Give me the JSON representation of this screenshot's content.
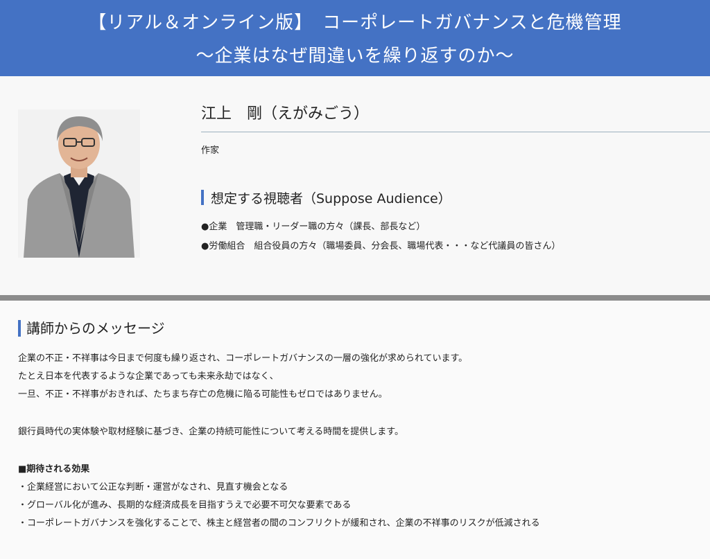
{
  "header": {
    "title_line1": "【リアル＆オンライン版】　コーポレートガバナンスと危機管理",
    "title_line2": "～企業はなぜ間違いを繰り返すのか～",
    "bg_color": "#4472c4"
  },
  "profile": {
    "name": "江上　剛（えがみごう）",
    "occupation": "作家",
    "audience_heading": "想定する視聴者（Suppose Audience）",
    "audience_items": [
      "●企業　管理職・リーダー職の方々（課長、部長など）",
      "●労働組合　組合役員の方々（職場委員、分会長、職場代表・・・など代議員の皆さん）"
    ]
  },
  "message": {
    "heading": "講師からのメッセージ",
    "paragraph1": [
      "企業の不正・不祥事は今日まで何度も繰り返され、コーポレートガバナンスの一層の強化が求められています。",
      "たとえ日本を代表するような企業であっても未来永劫ではなく、",
      "一旦、不正・不祥事がおきれば、たちまち存亡の危機に陥る可能性もゼロではありません。"
    ],
    "paragraph2": "銀行員時代の実体験や取材経験に基づき、企業の持続可能性について考える時間を提供します。",
    "effects_heading": "■期待される効果",
    "effects": [
      "・企業経営において公正な判断・運営がなされ、見直す機会となる",
      "・グローバル化が進み、長期的な経済成長を目指すうえで必要不可欠な要素である",
      "・コーポレートガバナンスを強化することで、株主と経営者の間のコンフリクトが緩和され、企業の不祥事のリスクが低減される"
    ]
  }
}
